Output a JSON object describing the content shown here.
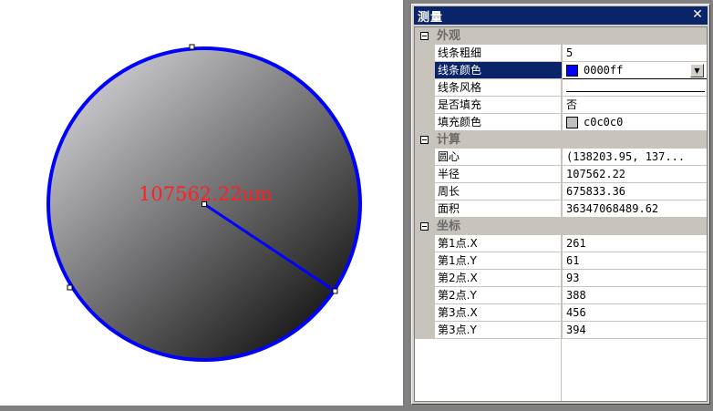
{
  "canvas": {
    "radius_label": "107562.22um",
    "label_color": "#ff2020",
    "outline_color": "#0000ff",
    "fill_gradient": [
      "#c8c8cc",
      "#1a1a1a"
    ]
  },
  "panel": {
    "title": "测量",
    "close_symbol": "✕",
    "categories": [
      {
        "label": "外观",
        "props": [
          {
            "name": "线条粗细",
            "value": "5"
          },
          {
            "name": "线条颜色",
            "value": "0000ff",
            "swatch": "#0000ff",
            "selected": true,
            "dropdown": true
          },
          {
            "name": "线条风格",
            "value": "",
            "line": true
          },
          {
            "name": "是否填充",
            "value": "否"
          },
          {
            "name": "填充颜色",
            "value": "c0c0c0",
            "swatch": "#c0c0c0"
          }
        ]
      },
      {
        "label": "计算",
        "props": [
          {
            "name": "圆心",
            "value": "(138203.95, 137..."
          },
          {
            "name": "半径",
            "value": "107562.22"
          },
          {
            "name": "周长",
            "value": "675833.36"
          },
          {
            "name": "面积",
            "value": "36347068489.62"
          }
        ]
      },
      {
        "label": "坐标",
        "props": [
          {
            "name": "第1点.X",
            "value": "261"
          },
          {
            "name": "第1点.Y",
            "value": "61"
          },
          {
            "name": "第2点.X",
            "value": "93"
          },
          {
            "name": "第2点.Y",
            "value": "388"
          },
          {
            "name": "第3点.X",
            "value": "456"
          },
          {
            "name": "第3点.Y",
            "value": "394"
          }
        ]
      }
    ]
  }
}
